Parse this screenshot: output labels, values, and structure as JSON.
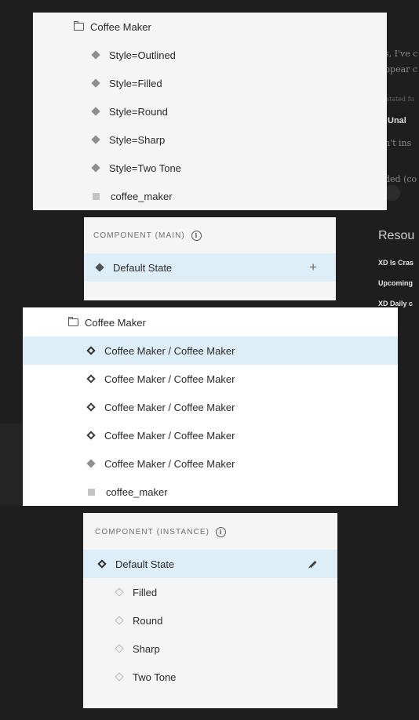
{
  "background": {
    "snippets": [
      "s, I've c",
      "ppear c",
      "stated fu",
      "Unal",
      "n't ins",
      "ded (co"
    ],
    "resources_heading": "Resou",
    "links": [
      "XD Is Cras",
      "Upcoming",
      "XD Daily c"
    ]
  },
  "panel_main_layers": {
    "folder_label": "Coffee Maker",
    "items": [
      {
        "label": "Style=Outlined"
      },
      {
        "label": "Style=Filled"
      },
      {
        "label": "Style=Round"
      },
      {
        "label": "Style=Sharp"
      },
      {
        "label": "Style=Two Tone"
      }
    ],
    "asset_label": "coffee_maker"
  },
  "panel_component_main": {
    "section_label": "COMPONENT (MAIN)",
    "state_label": "Default State",
    "add_label": "+"
  },
  "panel_instance_layers": {
    "folder_label": "Coffee Maker",
    "items": [
      {
        "label": "Coffee Maker / Coffee Maker"
      },
      {
        "label": "Coffee Maker / Coffee Maker"
      },
      {
        "label": "Coffee Maker / Coffee Maker"
      },
      {
        "label": "Coffee Maker / Coffee Maker"
      },
      {
        "label": "Coffee Maker / Coffee Maker"
      }
    ],
    "asset_label": "coffee_maker"
  },
  "panel_component_instance": {
    "section_label": "COMPONENT (INSTANCE)",
    "default_state_label": "Default State",
    "states": [
      {
        "label": "Filled"
      },
      {
        "label": "Round"
      },
      {
        "label": "Sharp"
      },
      {
        "label": "Two Tone"
      }
    ]
  },
  "colors": {
    "selected_row": "#ddeef8",
    "panel_bg": "#f5f5f5",
    "page_bg": "#1e1e1e"
  }
}
